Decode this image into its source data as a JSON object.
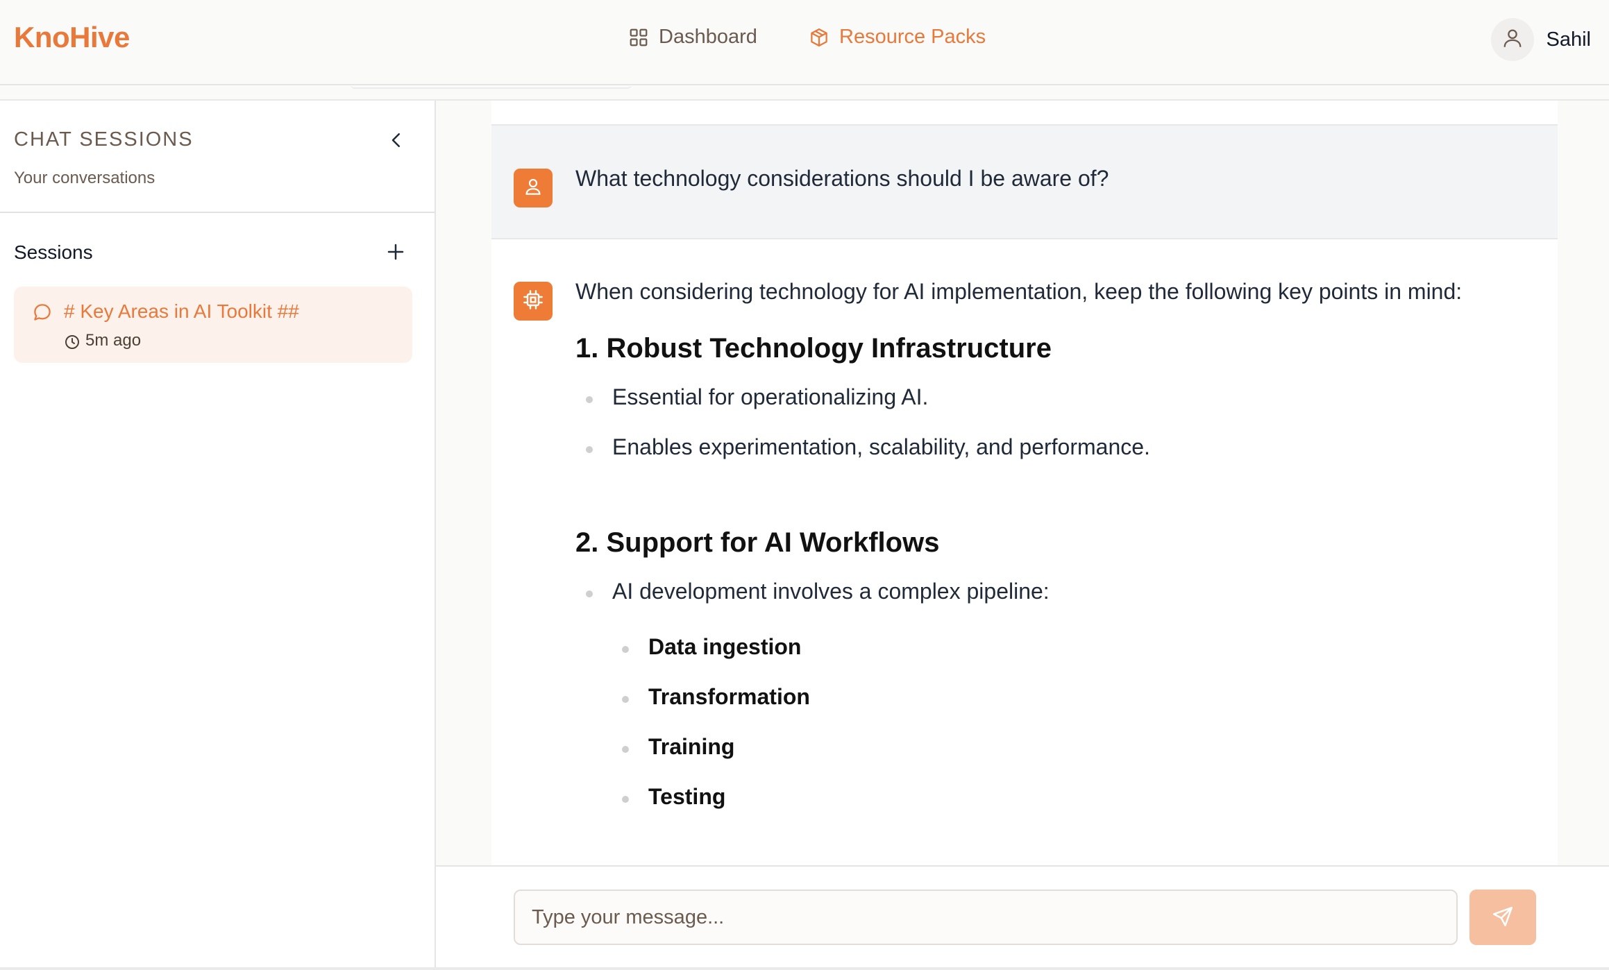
{
  "header": {
    "brand": "KnoHive",
    "nav": [
      {
        "label": "Dashboard",
        "icon": "grid-icon"
      },
      {
        "label": "Resource Packs",
        "icon": "package-icon"
      }
    ],
    "user": {
      "name": "Sahil",
      "icon": "user-icon"
    }
  },
  "sidebar": {
    "title": "CHAT SESSIONS",
    "subtitle": "Your conversations",
    "sessions_label": "Sessions",
    "sessions": [
      {
        "title": "# Key Areas in AI Toolkit ##",
        "time": "5m ago"
      }
    ]
  },
  "conversation": {
    "user_message": "What technology considerations should I be aware of?",
    "assistant": {
      "intro": "When considering technology for AI implementation, keep the following key points in mind:",
      "sections": [
        {
          "heading": "1. Robust Technology Infrastructure",
          "bullets": [
            "Essential for operationalizing AI.",
            "Enables experimentation, scalability, and performance."
          ]
        },
        {
          "heading": "2. Support for AI Workflows",
          "bullets": [
            "AI development involves a complex pipeline:"
          ],
          "sub_bullets": [
            "Data ingestion",
            "Transformation",
            "Training",
            "Testing"
          ]
        }
      ]
    }
  },
  "composer": {
    "placeholder": "Type your message...",
    "value": ""
  },
  "colors": {
    "accent": "#e8793a",
    "accent_soft": "#fdf1ec",
    "send_button": "#f6bf9f",
    "muted_text": "#6b5a4e"
  }
}
